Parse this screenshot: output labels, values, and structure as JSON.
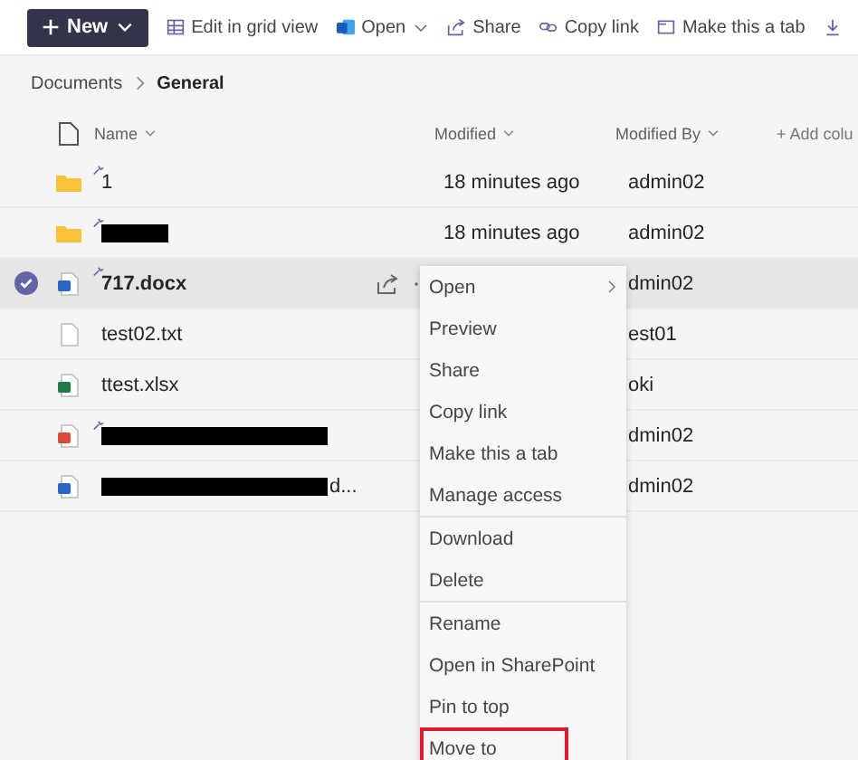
{
  "toolbar": [
    {
      "kind": "new",
      "label": "New"
    },
    {
      "kind": "grid",
      "label": "Edit in grid view"
    },
    {
      "kind": "open",
      "label": "Open"
    },
    {
      "kind": "share",
      "label": "Share"
    },
    {
      "kind": "link",
      "label": "Copy link"
    },
    {
      "kind": "tab",
      "label": "Make this a tab"
    },
    {
      "kind": "download"
    }
  ],
  "breadcrumb": [
    "Documents",
    "General"
  ],
  "columns": [
    "Name",
    "Modified",
    "Modified By",
    "+ Add colu"
  ],
  "rows": [
    {
      "kind": "folder",
      "name": "1",
      "redacted": false,
      "new": true,
      "selected": false,
      "modified": "18 minutes ago",
      "modified_by": "admin02"
    },
    {
      "kind": "folder",
      "redacted": true,
      "new": true,
      "selected": false,
      "modified": "18 minutes ago",
      "modified_by": "admin02"
    },
    {
      "kind": "word",
      "name": "717.docx",
      "redacted": false,
      "new": true,
      "selected": true,
      "modified_by": "dmin02"
    },
    {
      "kind": "text",
      "name": "test02.txt",
      "redacted": false,
      "new": false,
      "selected": false,
      "modified_by": "est01"
    },
    {
      "kind": "excel",
      "name": "ttest.xlsx",
      "redacted": false,
      "new": false,
      "selected": false,
      "modified_by": "oki"
    },
    {
      "kind": "pdf",
      "redacted": true,
      "new": true,
      "selected": false,
      "modified_by": "dmin02"
    },
    {
      "kind": "word",
      "redacted": true,
      "name_tail": "d...",
      "new": false,
      "selected": false,
      "modified_by": "dmin02"
    }
  ],
  "menu": [
    [
      {
        "label": "Open",
        "submenu": true,
        "highlighted": false
      },
      {
        "label": "Preview",
        "submenu": false,
        "highlighted": false
      },
      {
        "label": "Share",
        "submenu": false,
        "highlighted": false
      },
      {
        "label": "Copy link",
        "submenu": false,
        "highlighted": false
      },
      {
        "label": "Make this a tab",
        "submenu": false,
        "highlighted": false
      },
      {
        "label": "Manage access",
        "submenu": false,
        "highlighted": false
      }
    ],
    [
      {
        "label": "Download",
        "submenu": false,
        "highlighted": false
      },
      {
        "label": "Delete",
        "submenu": false,
        "highlighted": false
      }
    ],
    [
      {
        "label": "Rename",
        "submenu": false,
        "highlighted": false
      },
      {
        "label": "Open in SharePoint",
        "submenu": false,
        "highlighted": false
      },
      {
        "label": "Pin to top",
        "submenu": false,
        "highlighted": false
      },
      {
        "label": "Move to",
        "submenu": false,
        "highlighted": true
      }
    ]
  ]
}
